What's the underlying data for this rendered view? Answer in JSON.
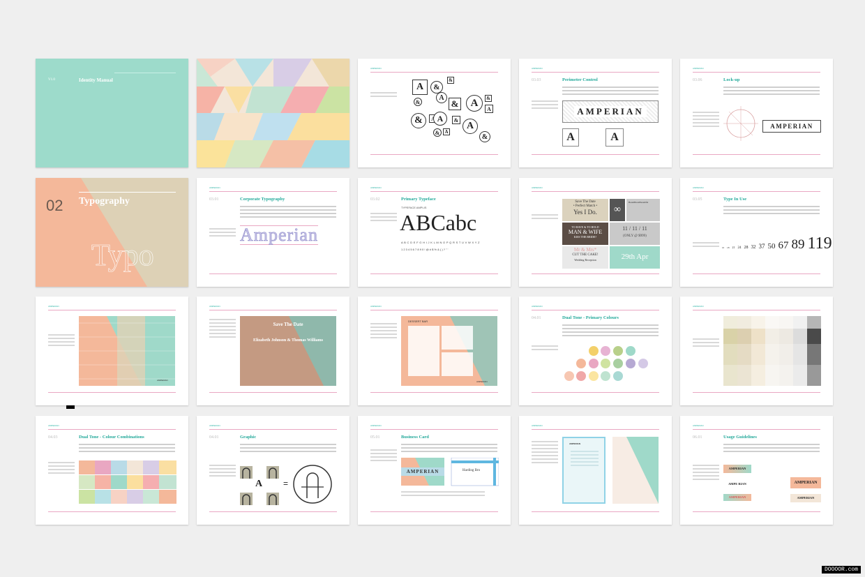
{
  "cover": {
    "version": "V1.0",
    "title": "Identity Manual"
  },
  "typo": {
    "number": "02",
    "title": "Typography"
  },
  "section": "AMPERIAN",
  "cards": {
    "perimeter": {
      "num": "03.03",
      "title": "Perimeter Control",
      "word": "AMPERIAN",
      "a": "A"
    },
    "lockup": {
      "num": "03.06",
      "title": "Lock-up",
      "word": "AMPERIAN"
    },
    "corp": {
      "num": "03.01",
      "title": "Corporate Typography",
      "word": "Amperian"
    },
    "primary": {
      "num": "03.02",
      "title": "Primary Typeface",
      "sub": "TYPEFACE AMPLIS",
      "specimen": "ABCabc",
      "alpha": "A B C D E F G H I J K L M N O P Q R S T U V W X Y Z",
      "digits": "1 2 3 4 5 6 7 8 9 0 ! @ # $ % & ( ) ? \" '"
    },
    "poster": {
      "t1": "Save The Date",
      "t2": "• Perfect Match •",
      "t3": "Yes I Do.",
      "t4": "TO HAVE & TO HOLD",
      "t5": "MAN & WIFE",
      "t6": "KISS THE BRIDE?",
      "t7": "Mr & Mrs*",
      "t8": "CUT THE CAKE!",
      "t9": "Wedding Reception",
      "d1": "11 / 11 / 11",
      "d2": "(ONLY @ $999)",
      "d3": "29th Apr",
      "d4": "BeamBeanBeautiful"
    },
    "typeinuse": {
      "num": "03.05",
      "title": "Type In Use",
      "sizes": [
        "16",
        "18",
        "21",
        "24",
        "28",
        "32",
        "37",
        "50",
        "67",
        "89",
        "119"
      ]
    },
    "invite": {
      "text": "AMPERIAN"
    },
    "savedate": {
      "t1": "Save The Date",
      "t2": "Elizabeth Johnson & Thomas Williams"
    },
    "dessert": {
      "t1": "DESSERT BAR",
      "t2": "AMPERIAN"
    },
    "dualtone": {
      "num": "04.01",
      "title": "Dual Tone - Primary Colours"
    },
    "combos": {
      "num": "04.03",
      "title": "Dual Tone - Colour Combinations"
    },
    "graphic": {
      "num": "04.01",
      "title": "Graphic",
      "a": "A",
      "eq": "="
    },
    "business": {
      "num": "05.01",
      "title": "Business Card",
      "word": "AMPERIAN",
      "name": "Harding Bro"
    },
    "usage": {
      "num": "06.01",
      "title": "Usage Guidelines",
      "words": [
        "AMPERIAN",
        "AMPE RIAN",
        "AMPERIAN",
        "AMPERIAN",
        "AMPERIAN"
      ]
    }
  },
  "watermark": "DOOOOR.com",
  "colors": {
    "teal": "#23a99a",
    "pink": "#e9a7c2",
    "mint": "#9fd9c9",
    "peach": "#f4b89a",
    "sand": "#ddd1b6"
  }
}
